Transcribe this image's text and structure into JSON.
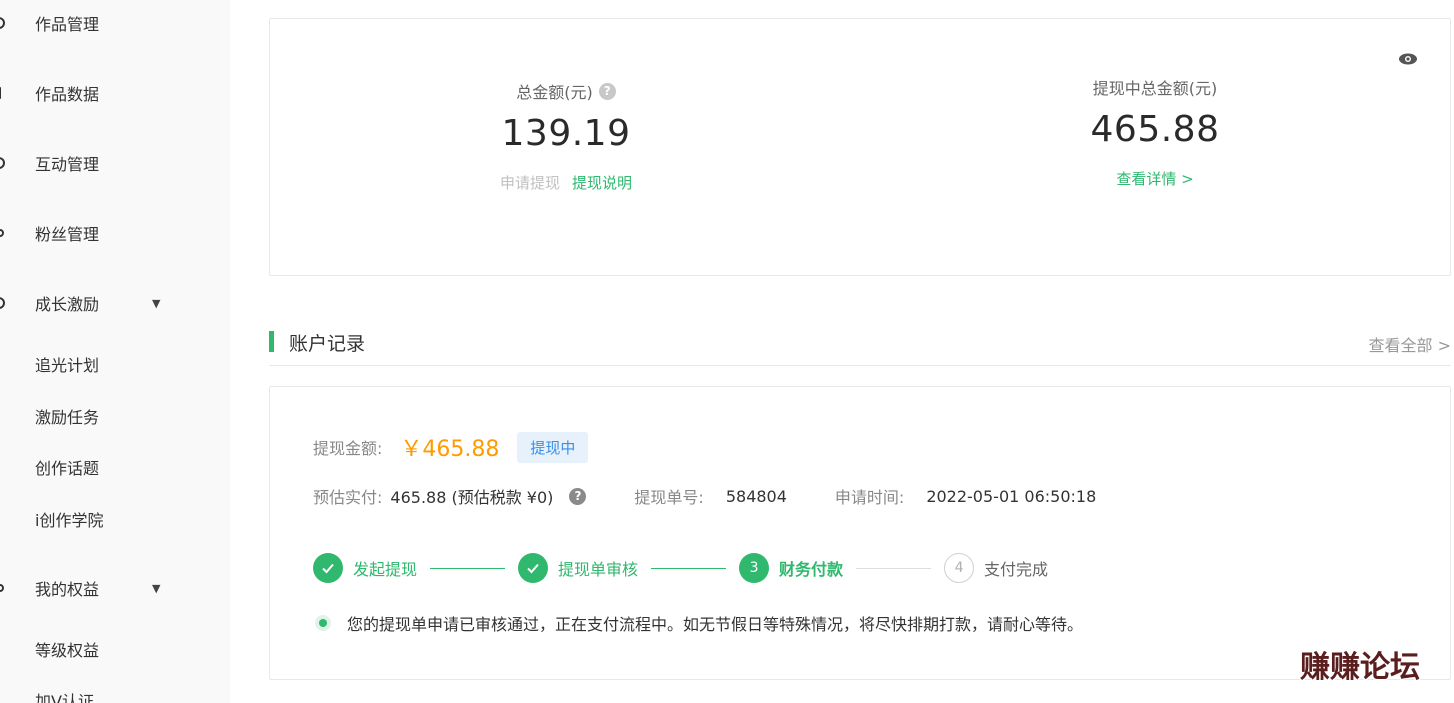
{
  "sidebar": {
    "items": [
      {
        "label": "作品管理"
      },
      {
        "label": "作品数据"
      },
      {
        "label": "互动管理"
      },
      {
        "label": "粉丝管理"
      },
      {
        "label": "成长激励",
        "sub": [
          "追光计划",
          "激励任务",
          "创作话题",
          "i创作学院"
        ]
      },
      {
        "label": "我的权益",
        "sub": [
          "等级权益",
          "加V认证"
        ]
      }
    ]
  },
  "summary": {
    "total_label": "总金额(元)",
    "total_value": "139.19",
    "apply_label": "申请提现",
    "explain_label": "提现说明",
    "pending_label": "提现中总金额(元)",
    "pending_value": "465.88",
    "detail_label": "查看详情 >"
  },
  "records": {
    "title": "账户记录",
    "view_all": "查看全部 >",
    "amount_label": "提现金额:",
    "amount_value": "￥465.88",
    "status": "提现中",
    "est_label": "预估实付:",
    "est_value": "465.88 (预估税款 ¥0)",
    "order_label": "提现单号:",
    "order_value": "584804",
    "time_label": "申请时间:",
    "time_value": "2022-05-01 06:50:18",
    "steps": [
      {
        "label": "发起提现",
        "state": "done"
      },
      {
        "label": "提现单审核",
        "state": "done"
      },
      {
        "label": "财务付款",
        "state": "active",
        "num": "3"
      },
      {
        "label": "支付完成",
        "state": "pending",
        "num": "4"
      }
    ],
    "note": "您的提现单申请已审核通过，正在支付流程中。如无节假日等特殊情况，将尽快排期打款，请耐心等待。"
  },
  "watermark": "赚赚论坛",
  "colors": {
    "accent": "#2fb86e",
    "amount": "#ff9b00",
    "badge_bg": "#e6f1fc",
    "badge_text": "#3b8ee5"
  }
}
